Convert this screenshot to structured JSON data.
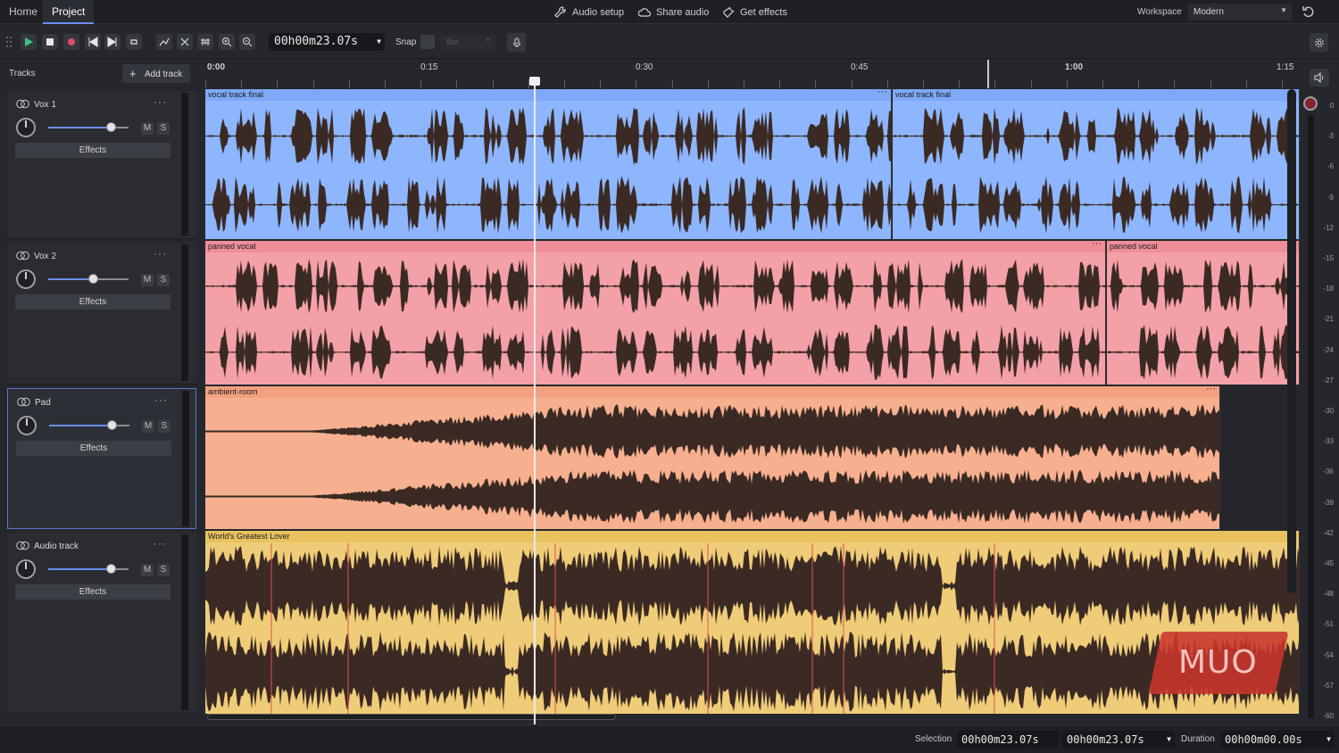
{
  "menubar": {
    "tabs": [
      {
        "label": "Home"
      },
      {
        "label": "Project",
        "active": true
      }
    ],
    "links": [
      {
        "label": "Audio setup",
        "icon": "wrench-icon"
      },
      {
        "label": "Share audio",
        "icon": "cloud-icon"
      },
      {
        "label": "Get effects",
        "icon": "plugin-icon"
      }
    ],
    "workspace_label": "Workspace",
    "workspace_value": "Modern"
  },
  "toolbar": {
    "time": "00h00m23.07s",
    "snap_label": "Snap",
    "snap_value": "Bar"
  },
  "tracks_panel": {
    "title": "Tracks",
    "add_track_label": "Add track",
    "effects_label": "Effects",
    "mute_label": "M",
    "solo_label": "S"
  },
  "ruler": {
    "labels": [
      "0:00",
      "0:15",
      "0:30",
      "0:45",
      "1:00",
      "1:15"
    ]
  },
  "tracks": [
    {
      "name": "Vox 1",
      "volume": 0.78,
      "clips": [
        {
          "title": "vocal track final"
        },
        {
          "title": "vocal track final"
        }
      ],
      "color": "#8db6ff"
    },
    {
      "name": "Vox 2",
      "volume": 0.55,
      "clips": [
        {
          "title": "panned vocal"
        },
        {
          "title": "panned vocal"
        }
      ],
      "color": "#f4a0a8"
    },
    {
      "name": "Pad",
      "volume": 0.78,
      "clips": [
        {
          "title": "ambient-room"
        }
      ],
      "color": "#f7b08f"
    },
    {
      "name": "Audio track",
      "volume": 0.78,
      "clips": [
        {
          "title": "World's Greatest Lover"
        }
      ],
      "color": "#efcc78"
    }
  ],
  "meter": {
    "db_labels": [
      "0",
      "-3",
      "-6",
      "-9",
      "-12",
      "-15",
      "-18",
      "-21",
      "-24",
      "-27",
      "-30",
      "-33",
      "-36",
      "-39",
      "-42",
      "-45",
      "-48",
      "-51",
      "-54",
      "-57",
      "-60"
    ]
  },
  "statusbar": {
    "selection_label": "Selection",
    "selection_start": "00h00m23.07s",
    "selection_end": "00h00m23.07s",
    "duration_label": "Duration",
    "duration_value": "00h00m00.00s"
  },
  "watermark": {
    "text": "MUO"
  }
}
